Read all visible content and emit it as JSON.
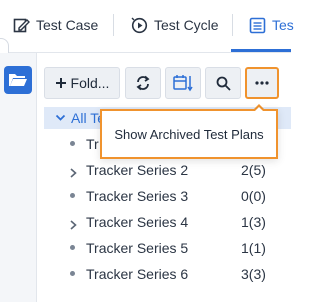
{
  "tabs": [
    {
      "label": "Test Case",
      "icon": "test-case-edit-icon"
    },
    {
      "label": "Test Cycle",
      "icon": "test-cycle-play-icon"
    },
    {
      "label": "Tes",
      "icon": "test-plan-list-icon",
      "active": true
    }
  ],
  "toolbar": {
    "new_folder_label": "Fold...",
    "buttons": [
      "plus-icon",
      "refresh-icon",
      "calendar-sort-icon",
      "search-icon",
      "more-icon"
    ]
  },
  "tree": {
    "root_label": "All Te",
    "items": [
      {
        "label": "Tr",
        "count": "",
        "expandable": false
      },
      {
        "label": "Tracker Series 2",
        "count": "2(5)",
        "expandable": true
      },
      {
        "label": "Tracker Series 3",
        "count": "0(0)",
        "expandable": false
      },
      {
        "label": "Tracker Series 4",
        "count": "1(3)",
        "expandable": true
      },
      {
        "label": "Tracker Series 5",
        "count": "1(1)",
        "expandable": false
      },
      {
        "label": "Tracker Series 6",
        "count": "3(3)",
        "expandable": false
      }
    ]
  },
  "popup": {
    "menu_item": "Show Archived Test Plans"
  },
  "colors": {
    "accent": "#2d6fd6",
    "highlight": "#f0932e",
    "selected_bg": "#dfe9f8"
  }
}
